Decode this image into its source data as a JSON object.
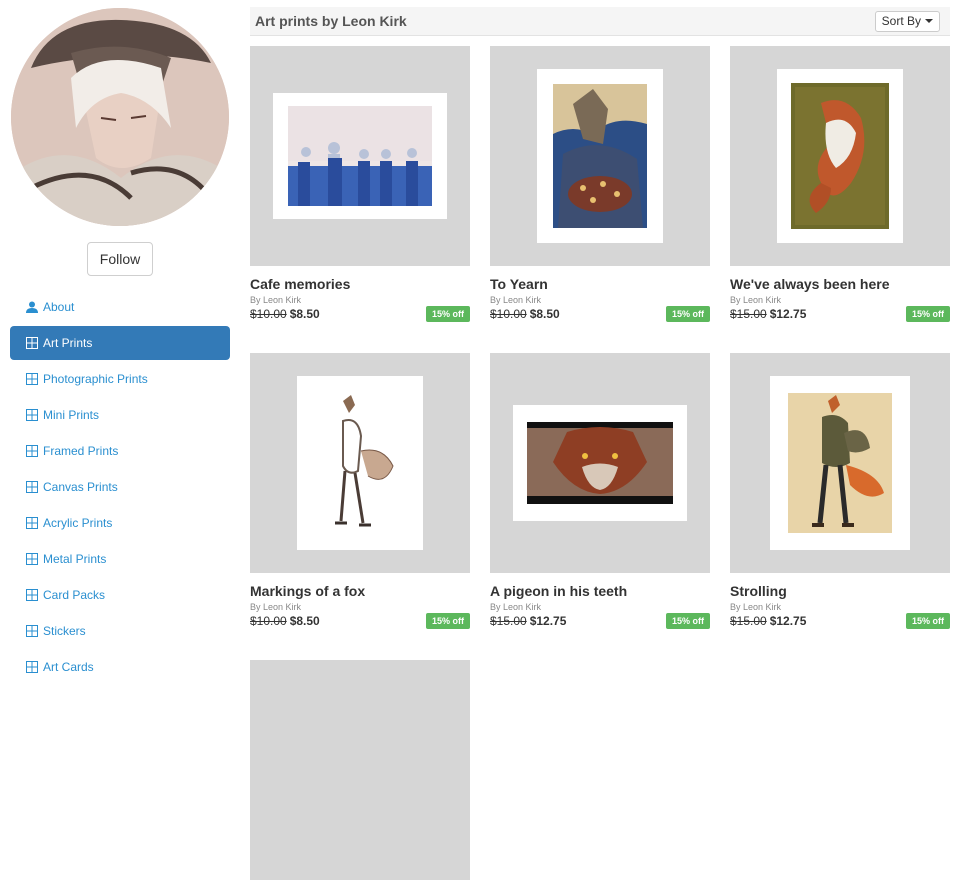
{
  "sidebar": {
    "follow_label": "Follow",
    "items": [
      {
        "label": "About",
        "icon": "user-icon",
        "active": false
      },
      {
        "label": "Art Prints",
        "icon": "grid-icon",
        "active": true
      },
      {
        "label": "Photographic Prints",
        "icon": "grid-icon",
        "active": false
      },
      {
        "label": "Mini Prints",
        "icon": "grid-icon",
        "active": false
      },
      {
        "label": "Framed Prints",
        "icon": "grid-icon",
        "active": false
      },
      {
        "label": "Canvas Prints",
        "icon": "grid-icon",
        "active": false
      },
      {
        "label": "Acrylic Prints",
        "icon": "grid-icon",
        "active": false
      },
      {
        "label": "Metal Prints",
        "icon": "grid-icon",
        "active": false
      },
      {
        "label": "Card Packs",
        "icon": "grid-icon",
        "active": false
      },
      {
        "label": "Stickers",
        "icon": "grid-icon",
        "active": false
      },
      {
        "label": "Art Cards",
        "icon": "grid-icon",
        "active": false
      }
    ]
  },
  "header": {
    "title": "Art prints by Leon Kirk",
    "sort_label": "Sort By"
  },
  "products": [
    {
      "title": "Cafe memories",
      "byline": "By Leon Kirk",
      "old_price": "$10.00",
      "price": "$8.50",
      "badge": "15% off"
    },
    {
      "title": "To Yearn",
      "byline": "By Leon Kirk",
      "old_price": "$10.00",
      "price": "$8.50",
      "badge": "15% off"
    },
    {
      "title": "We've always been here",
      "byline": "By Leon Kirk",
      "old_price": "$15.00",
      "price": "$12.75",
      "badge": "15% off"
    },
    {
      "title": "Markings of a fox",
      "byline": "By Leon Kirk",
      "old_price": "$10.00",
      "price": "$8.50",
      "badge": "15% off"
    },
    {
      "title": "A pigeon in his teeth",
      "byline": "By Leon Kirk",
      "old_price": "$15.00",
      "price": "$12.75",
      "badge": "15% off"
    },
    {
      "title": "Strolling",
      "byline": "By Leon Kirk",
      "old_price": "$15.00",
      "price": "$12.75",
      "badge": "15% off"
    }
  ],
  "colors": {
    "accent": "#337ab7",
    "link": "#2a8fd0",
    "badge": "#5cb85c",
    "thumb_bg": "#d6d6d6"
  }
}
